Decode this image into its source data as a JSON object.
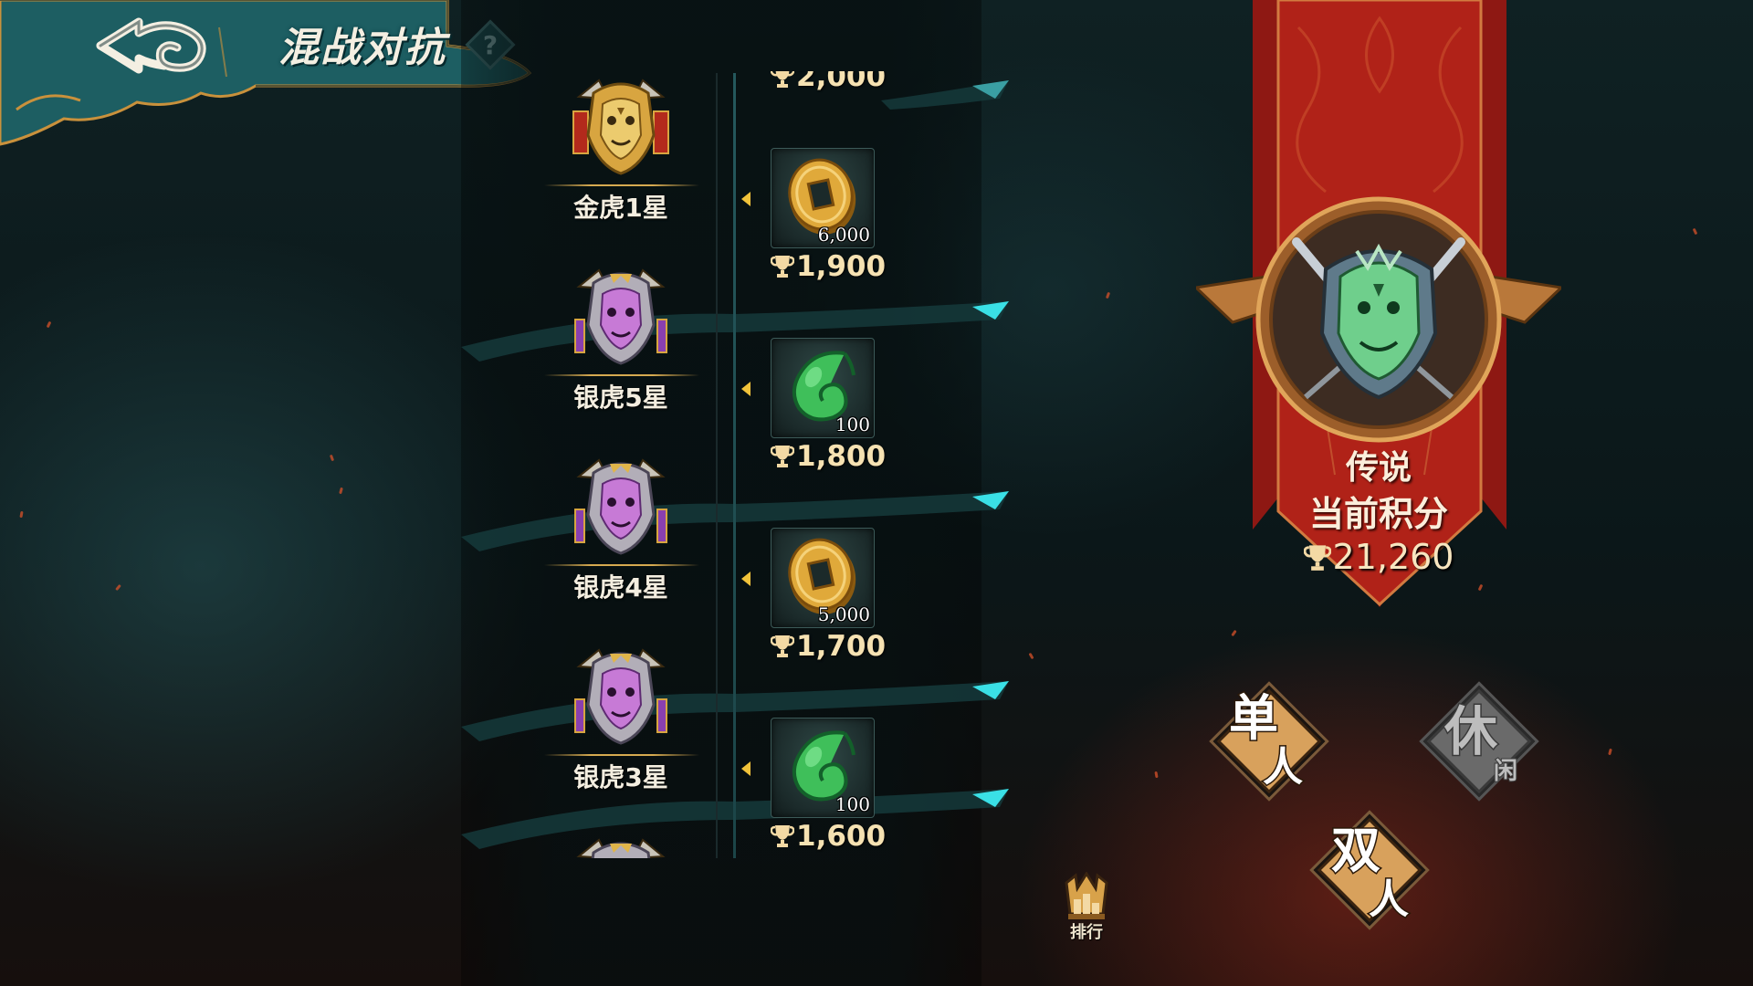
{
  "header": {
    "title": "混战对抗",
    "help_label": "?"
  },
  "tier_ladder": [
    {
      "tier": "金虎1星",
      "points": "2,000",
      "emblem": "gold-tiger-emblem",
      "reward": {
        "icon": "copper-coin-icon",
        "quantity": "6,000"
      }
    },
    {
      "tier": "银虎5星",
      "points": "1,900",
      "emblem": "silver-tiger-emblem",
      "reward": {
        "icon": "jade-icon",
        "quantity": "100"
      }
    },
    {
      "tier": "银虎4星",
      "points": "1,800",
      "emblem": "silver-tiger-emblem",
      "reward": {
        "icon": "copper-coin-icon",
        "quantity": "5,000"
      }
    },
    {
      "tier": "银虎3星",
      "points": "1,700",
      "emblem": "silver-tiger-emblem",
      "reward": {
        "icon": "jade-icon",
        "quantity": "100"
      }
    },
    {
      "tier": "",
      "points": "1,600",
      "emblem": "silver-tiger-emblem",
      "reward": null
    }
  ],
  "rank": {
    "tier_name": "传说",
    "score_label": "当前积分",
    "score": "21,260",
    "badge_icon": "legend-green-beast-emblem"
  },
  "modes": {
    "single": {
      "label_main": "单",
      "label_sub": "人",
      "enabled": true
    },
    "double": {
      "label_main": "双",
      "label_sub": "人",
      "enabled": true
    },
    "casual": {
      "label_main": "休",
      "label_sub": "闲",
      "enabled": false
    }
  },
  "ranking": {
    "label": "排行"
  },
  "colors": {
    "banner_red": "#a51d17",
    "gold": "#c9913c",
    "title_text": "#f4efe2",
    "teal": "#1f6a6c"
  }
}
